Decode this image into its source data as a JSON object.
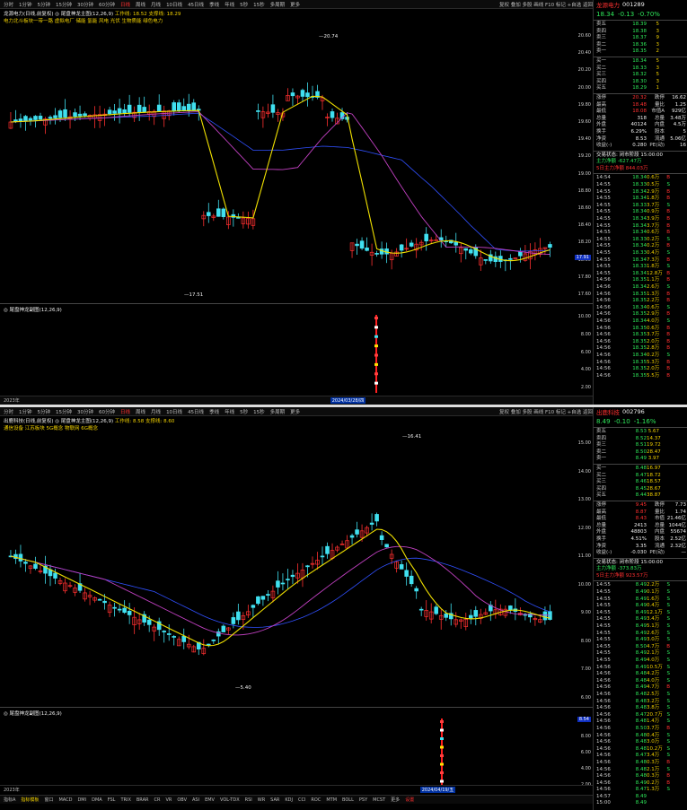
{
  "top": {
    "toolbar": [
      "分时",
      "1分钟",
      "5分钟",
      "15分钟",
      "30分钟",
      "60分钟",
      "日线",
      "周线",
      "月线",
      "10日线",
      "45日线",
      "季线",
      "年线",
      "5秒",
      "15秒",
      "多周期",
      "更多"
    ],
    "toolbar_selected": "日线",
    "toolbar_right": "复权 叠加 多股 画线 F10 标记 +自选 返回",
    "indicator_line": "龙源电力(日线,前复权)",
    "indicator_main": "◎ 尾盘神龙主图(12,26,9)",
    "indicator_values": "工作线: 18.52  支撑线: 18.29",
    "signal_line": "电力北斗板块一带一路 虚拟电厂 储能 氢能 风电 光伏 生物质能 绿色电力",
    "price_high_label": "20.74",
    "price_low_label": "17.51",
    "axis_labels": [
      "20.60",
      "20.40",
      "20.20",
      "20.00",
      "19.80",
      "19.60",
      "19.40",
      "19.20",
      "19.00",
      "18.80",
      "18.60",
      "18.40",
      "18.20",
      "18.00",
      "17.80",
      "17.60"
    ],
    "axis_highlight": "17.91",
    "sub_legend": "◎ 尾盘神龙副图(12,26,9)",
    "sub_axis": [
      "10.00",
      "8.00",
      "6.00",
      "4.00",
      "2.00"
    ],
    "date_left": "2023年",
    "date_sel": "2024/03/28/四",
    "quote": {
      "name": "龙源电力",
      "code": "001289",
      "price": "18.34",
      "change": "-0.13",
      "pct": "-0.70%",
      "asks": [
        [
          "卖五",
          "18.39",
          "5"
        ],
        [
          "卖四",
          "18.38",
          "3"
        ],
        [
          "卖三",
          "18.37",
          "9"
        ],
        [
          "卖二",
          "18.36",
          "3"
        ],
        [
          "卖一",
          "18.35",
          "2"
        ]
      ],
      "bids": [
        [
          "买一",
          "18.34",
          "5"
        ],
        [
          "买二",
          "18.33",
          "3"
        ],
        [
          "买三",
          "18.32",
          "5"
        ],
        [
          "买四",
          "18.30",
          "3"
        ],
        [
          "买五",
          "18.29",
          "1"
        ]
      ],
      "stats": [
        [
          "涨停",
          "20.32",
          "跌停",
          "16.62"
        ],
        [
          "最高",
          "18.48",
          "量比",
          "1.25"
        ],
        [
          "最低",
          "18.08",
          "市值A",
          "929亿"
        ],
        [
          "总量",
          "318",
          "总量",
          "3.48万"
        ],
        [
          "外盘",
          "40124",
          "内盘",
          "4.5万"
        ],
        [
          "换手",
          "6.29%",
          "股本",
          "5"
        ],
        [
          "净资",
          "8.53",
          "流通",
          "5.06亿"
        ],
        [
          "收益(-)",
          "0.280",
          "PE(动)",
          "16"
        ]
      ],
      "status": "交易状态: 闭市阶段 15:00:00",
      "flow1": "主力净额 -627.47万",
      "flow2": "5日主力净额 844.03万",
      "ticks": [
        [
          "14:54",
          "18.34",
          "0.6万",
          "B"
        ],
        [
          "14:55",
          "18.33",
          "0.5万",
          "S"
        ],
        [
          "14:55",
          "18.34",
          "2.9万",
          "B"
        ],
        [
          "14:55",
          "18.34",
          "1.8万",
          "B"
        ],
        [
          "14:55",
          "18.33",
          "3.7万",
          "S"
        ],
        [
          "14:55",
          "18.34",
          "0.9万",
          "B"
        ],
        [
          "14:55",
          "18.34",
          "3.9万",
          "B"
        ],
        [
          "14:55",
          "18.34",
          "3.7万",
          "B"
        ],
        [
          "14:55",
          "18.34",
          "0.6万",
          "B"
        ],
        [
          "14:55",
          "18.33",
          "0.2万",
          "S"
        ],
        [
          "14:55",
          "18.34",
          "0.2万",
          "B"
        ],
        [
          "14:55",
          "18.33",
          "0.4万",
          "S"
        ],
        [
          "14:55",
          "18.34",
          "7.3万",
          "B"
        ],
        [
          "14:55",
          "18.33",
          "1.8万",
          "S"
        ],
        [
          "14:55",
          "18.34",
          "12.8万",
          "B"
        ],
        [
          "14:56",
          "18.35",
          "1.1万",
          "B"
        ],
        [
          "14:56",
          "18.34",
          "2.6万",
          "S"
        ],
        [
          "14:56",
          "18.35",
          "1.3万",
          "B"
        ],
        [
          "14:56",
          "18.35",
          "2.2万",
          "B"
        ],
        [
          "14:56",
          "18.34",
          "0.6万",
          "S"
        ],
        [
          "14:56",
          "18.35",
          "2.9万",
          "B"
        ],
        [
          "14:56",
          "18.34",
          "4.0万",
          "S"
        ],
        [
          "14:56",
          "18.35",
          "0.6万",
          "B"
        ],
        [
          "14:56",
          "18.35",
          "3.7万",
          "B"
        ],
        [
          "14:56",
          "18.35",
          "2.0万",
          "B"
        ],
        [
          "14:56",
          "18.35",
          "2.8万",
          "B"
        ],
        [
          "14:56",
          "18.34",
          "0.2万",
          "S"
        ],
        [
          "14:56",
          "18.35",
          "5.3万",
          "B"
        ],
        [
          "14:56",
          "18.35",
          "2.0万",
          "B"
        ],
        [
          "14:56",
          "18.35",
          "5.5万",
          "B"
        ]
      ]
    }
  },
  "bottom": {
    "toolbar": [
      "分时",
      "1分钟",
      "5分钟",
      "15分钟",
      "30分钟",
      "60分钟",
      "日线",
      "周线",
      "月线",
      "10日线",
      "45日线",
      "季线",
      "年线",
      "5秒",
      "15秒",
      "多周期",
      "更多"
    ],
    "toolbar_selected": "日线",
    "toolbar_right": "复权 叠加 多股 画线 F10 标记 +自选 返回",
    "indicator_line": "出鹿科技(日线,前复权)",
    "indicator_main": "◎ 尾盘神龙主图(12,26,9)",
    "indicator_values": "工作线: 8.58  支撑线: 8.60",
    "signal_line": "通信设备 江苏板块 5G概念 物联网 6G概念",
    "price_high_label": "16.41",
    "price_low_label": "5.40",
    "axis_labels": [
      "15.00",
      "14.00",
      "13.00",
      "12.00",
      "11.00",
      "10.00",
      "9.00",
      "8.00",
      "7.00",
      "6.00"
    ],
    "axis_highlight": "8.54",
    "sub_legend": "◎ 尾盘神龙副图(12,26,9)",
    "sub_axis": [
      "10.00",
      "8.00",
      "6.00",
      "4.00",
      "2.00"
    ],
    "date_left": "2023年",
    "date_sel": "2024/04/19/五",
    "bottom_tabs": [
      "指标A",
      "指标模板",
      "窗口",
      "MACD",
      "DMI",
      "DMA",
      "FSL",
      "TRIX",
      "BRAR",
      "CR",
      "VR",
      "OBV",
      "ASI",
      "EMV",
      "VOL-TDX",
      "RSI",
      "WR",
      "SAR",
      "KDJ",
      "CCI",
      "ROC",
      "MTM",
      "BOLL",
      "PSY",
      "MCST",
      "更多",
      "设置"
    ],
    "quote": {
      "name": "出鹿科技",
      "code": "002796",
      "price": "8.49",
      "change": "-0.10",
      "pct": "-1.16%",
      "asks": [
        [
          "卖五",
          "8.53",
          "5.67"
        ],
        [
          "卖四",
          "8.52",
          "14.37"
        ],
        [
          "卖三",
          "8.51",
          "19.72"
        ],
        [
          "卖二",
          "8.50",
          "28.47"
        ],
        [
          "卖一",
          "8.49",
          "3.97"
        ]
      ],
      "bids": [
        [
          "买一",
          "8.48",
          "16.97"
        ],
        [
          "买二",
          "8.47",
          "18.72"
        ],
        [
          "买三",
          "8.46",
          "18.57"
        ],
        [
          "买四",
          "8.45",
          "28.67"
        ],
        [
          "买五",
          "8.44",
          "38.87"
        ]
      ],
      "stats": [
        [
          "涨停",
          "9.45",
          "跌停",
          "7.73"
        ],
        [
          "最高",
          "8.87",
          "量比",
          "1.74"
        ],
        [
          "最低",
          "8.43",
          "市值",
          "21.46亿"
        ],
        [
          "总量",
          "2413",
          "总量",
          "1044亿"
        ],
        [
          "外盘",
          "48803",
          "内盘",
          "55674"
        ],
        [
          "换手",
          "4.51%",
          "股本",
          "2.52亿"
        ],
        [
          "净资",
          "3.35",
          "流通",
          "2.32亿"
        ],
        [
          "收益(-)",
          "-0.030",
          "PE(动)",
          "—"
        ]
      ],
      "status": "交易状态: 闭市阶段 15:00:00",
      "flow1": "主力净额 -373.83万",
      "flow2": "5日主力净额 923.57万",
      "ticks": [
        [
          "14:55",
          "8.49",
          "2.2万",
          "S"
        ],
        [
          "14:55",
          "8.49",
          "0.1万",
          "S"
        ],
        [
          "14:55",
          "8.49",
          "1.6万",
          "S"
        ],
        [
          "14:55",
          "8.49",
          "0.4万",
          "S"
        ],
        [
          "14:55",
          "8.49",
          "12.1万",
          "S"
        ],
        [
          "14:55",
          "8.49",
          "3.4万",
          "S"
        ],
        [
          "14:55",
          "8.49",
          "5.1万",
          "S"
        ],
        [
          "14:55",
          "8.49",
          "2.6万",
          "S"
        ],
        [
          "14:55",
          "8.49",
          "3.0万",
          "S"
        ],
        [
          "14:55",
          "8.50",
          "4.7万",
          "B"
        ],
        [
          "14:55",
          "8.49",
          "2.1万",
          "S"
        ],
        [
          "14:55",
          "8.49",
          "4.0万",
          "S"
        ],
        [
          "14:56",
          "8.49",
          "10.5万",
          "S"
        ],
        [
          "14:56",
          "8.48",
          "4.2万",
          "S"
        ],
        [
          "14:56",
          "8.48",
          "4.0万",
          "S"
        ],
        [
          "14:56",
          "8.49",
          "4.7万",
          "B"
        ],
        [
          "14:56",
          "8.48",
          "2.5万",
          "S"
        ],
        [
          "14:56",
          "8.48",
          "3.2万",
          "S"
        ],
        [
          "14:56",
          "8.48",
          "3.8万",
          "S"
        ],
        [
          "14:56",
          "8.47",
          "20.7万",
          "S"
        ],
        [
          "14:56",
          "8.48",
          "1.4万",
          "S"
        ],
        [
          "14:56",
          "8.50",
          "3.7万",
          "B"
        ],
        [
          "14:56",
          "8.48",
          "0.4万",
          "S"
        ],
        [
          "14:56",
          "8.48",
          "3.0万",
          "S"
        ],
        [
          "14:56",
          "8.48",
          "10.2万",
          "S"
        ],
        [
          "14:56",
          "8.47",
          "3.4万",
          "S"
        ],
        [
          "14:56",
          "8.48",
          "0.3万",
          "B"
        ],
        [
          "14:56",
          "8.48",
          "2.1万",
          "S"
        ],
        [
          "14:56",
          "8.48",
          "0.3万",
          "B"
        ],
        [
          "14:56",
          "8.49",
          "0.2万",
          "B"
        ],
        [
          "14:56",
          "8.47",
          "1.3万",
          "S"
        ],
        [
          "14:57",
          "8.49",
          "",
          ""
        ],
        [
          "15:00",
          "8.49",
          "",
          ""
        ]
      ]
    }
  },
  "colors": {
    "up": "#ff3030",
    "down": "#40e0f0",
    "ma": "#f0e000",
    "ma2": "#c040c0",
    "ma3": "#3050ff",
    "bg": "#000000"
  }
}
